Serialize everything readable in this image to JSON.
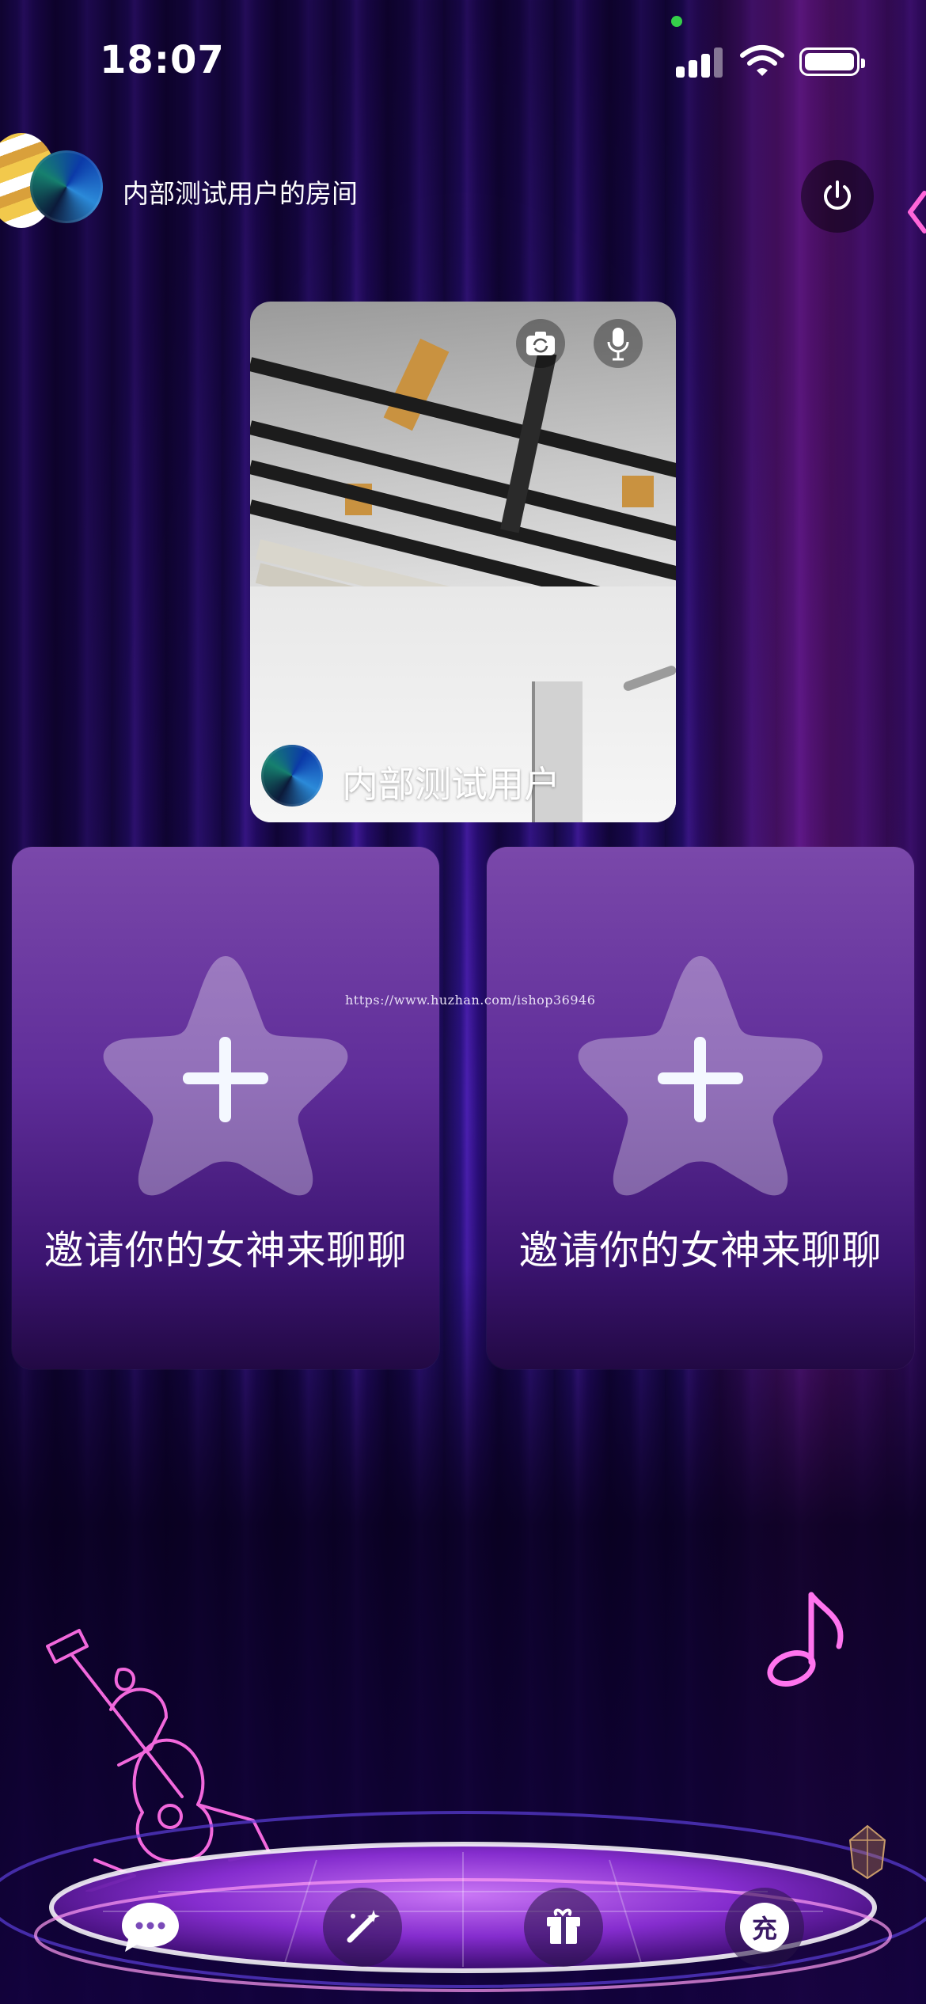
{
  "status_bar": {
    "time": "18:07"
  },
  "header": {
    "room_title": "内部测试用户的房间"
  },
  "video": {
    "host_name": "内部测试用户"
  },
  "invite_slots": [
    {
      "label": "邀请你的女神来聊聊"
    },
    {
      "label": "邀请你的女神来聊聊"
    }
  ],
  "watermark": "https://www.huzhan.com/ishop36946",
  "toolbar": {
    "charge_label": "充"
  },
  "icons": [
    "power-icon",
    "chevron-left-icon",
    "camera-switch-icon",
    "microphone-icon",
    "star-plus-icon",
    "chat-bubble-icon",
    "magic-wand-icon",
    "gift-icon",
    "charge-icon"
  ],
  "colors": {
    "card_purple": "#6a36a0",
    "neon_pink": "#ff66d9",
    "background": "#12063a"
  }
}
